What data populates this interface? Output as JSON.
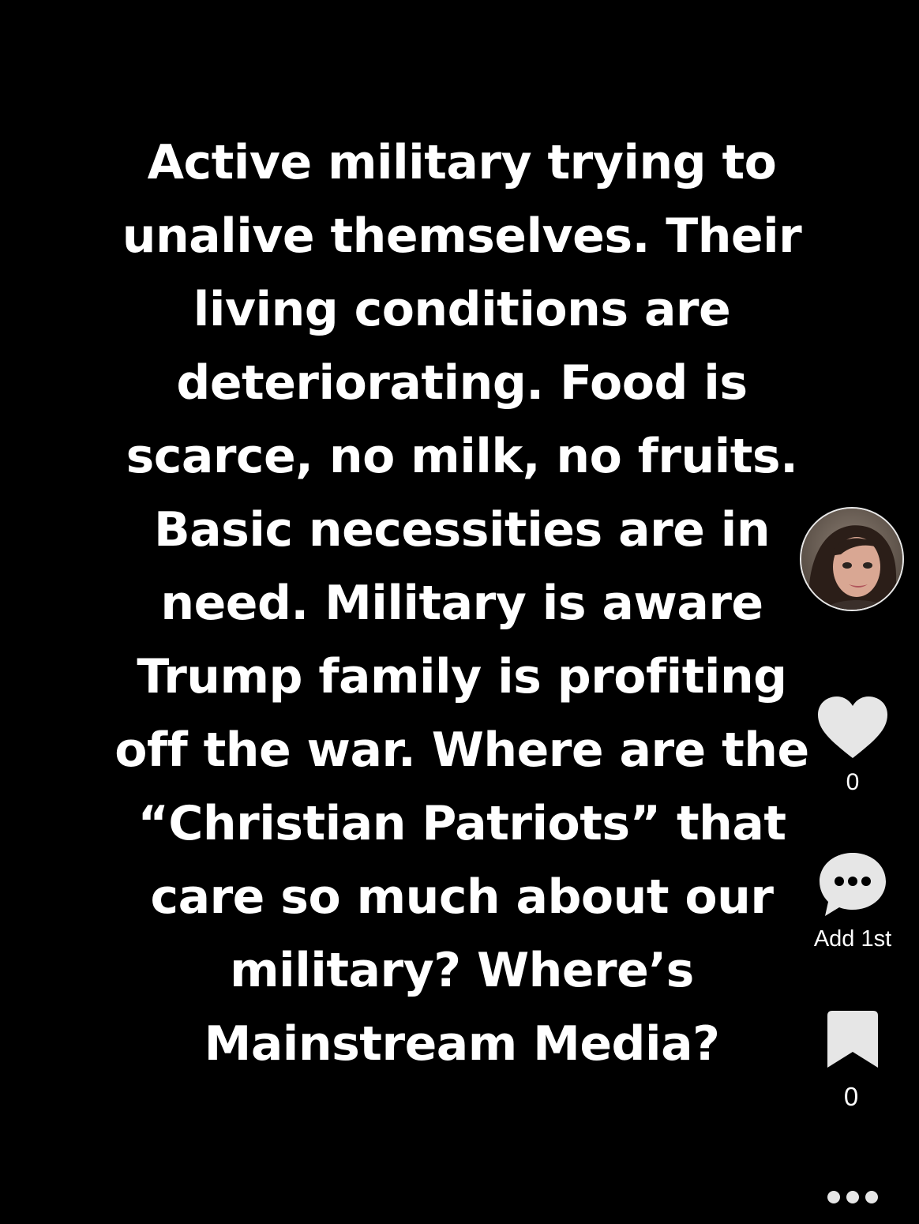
{
  "post": {
    "caption_lines": [
      "Active military trying to",
      "unalive themselves. Their",
      "living conditions are",
      "deteriorating. Food is",
      "scarce, no milk, no fruits.",
      "Basic necessities are in",
      "need. Military is aware",
      "Trump family is profiting",
      "off the war. Where are the",
      "“Christian Patriots” that",
      "care so much about our",
      "military? Where’s",
      "Mainstream Media?"
    ]
  },
  "actions": {
    "avatar_icon": "profile-avatar",
    "like_icon": "heart-icon",
    "like_count": "0",
    "comment_icon": "comment-bubble-icon",
    "comment_label": "Add 1st",
    "save_icon": "bookmark-icon",
    "save_count": "0",
    "more_icon": "more-icon"
  },
  "colors": {
    "background": "#000000",
    "text": "#ffffff",
    "icon": "#e6e6e6"
  }
}
